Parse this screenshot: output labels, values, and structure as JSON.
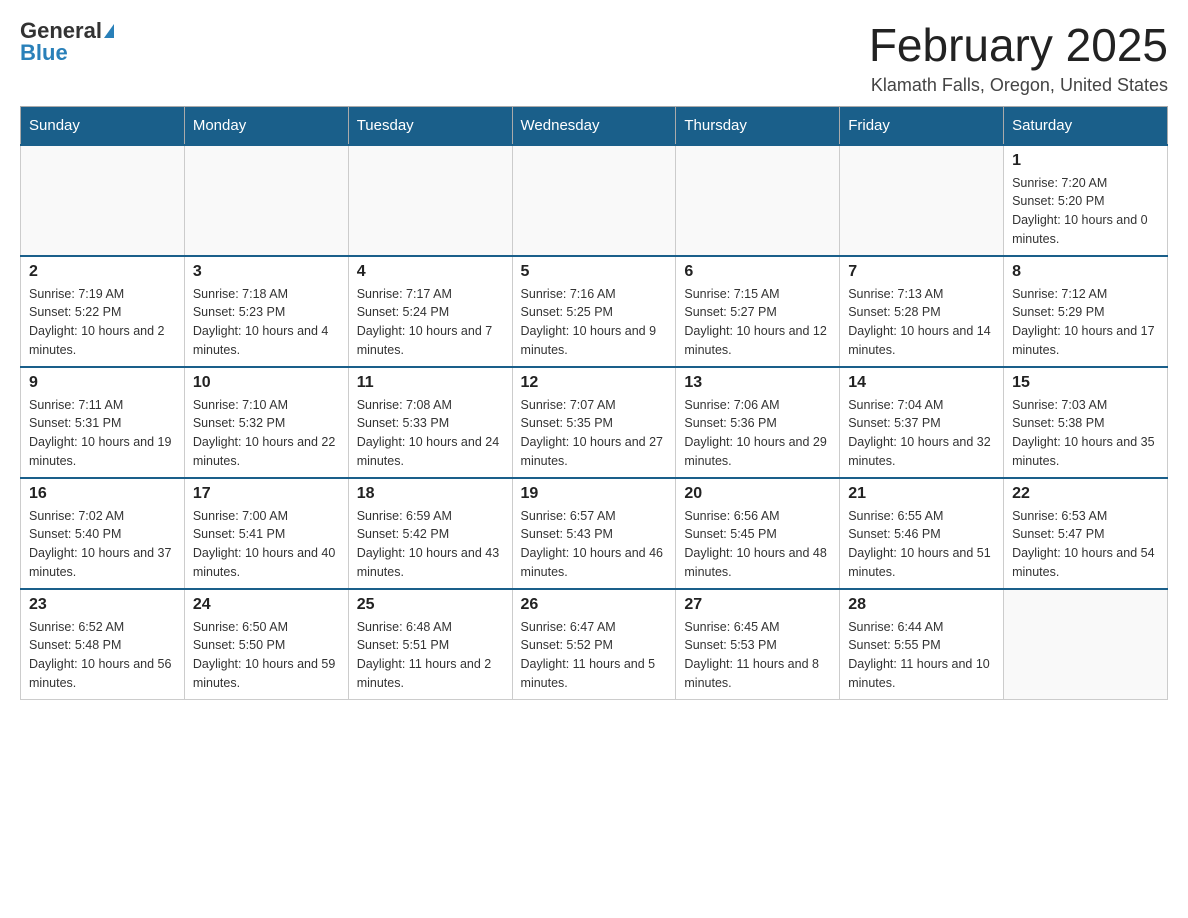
{
  "header": {
    "logo_general": "General",
    "logo_blue": "Blue",
    "title": "February 2025",
    "location": "Klamath Falls, Oregon, United States"
  },
  "days_of_week": [
    "Sunday",
    "Monday",
    "Tuesday",
    "Wednesday",
    "Thursday",
    "Friday",
    "Saturday"
  ],
  "weeks": [
    {
      "days": [
        {
          "date": "",
          "info": ""
        },
        {
          "date": "",
          "info": ""
        },
        {
          "date": "",
          "info": ""
        },
        {
          "date": "",
          "info": ""
        },
        {
          "date": "",
          "info": ""
        },
        {
          "date": "",
          "info": ""
        },
        {
          "date": "1",
          "info": "Sunrise: 7:20 AM\nSunset: 5:20 PM\nDaylight: 10 hours and 0 minutes."
        }
      ]
    },
    {
      "days": [
        {
          "date": "2",
          "info": "Sunrise: 7:19 AM\nSunset: 5:22 PM\nDaylight: 10 hours and 2 minutes."
        },
        {
          "date": "3",
          "info": "Sunrise: 7:18 AM\nSunset: 5:23 PM\nDaylight: 10 hours and 4 minutes."
        },
        {
          "date": "4",
          "info": "Sunrise: 7:17 AM\nSunset: 5:24 PM\nDaylight: 10 hours and 7 minutes."
        },
        {
          "date": "5",
          "info": "Sunrise: 7:16 AM\nSunset: 5:25 PM\nDaylight: 10 hours and 9 minutes."
        },
        {
          "date": "6",
          "info": "Sunrise: 7:15 AM\nSunset: 5:27 PM\nDaylight: 10 hours and 12 minutes."
        },
        {
          "date": "7",
          "info": "Sunrise: 7:13 AM\nSunset: 5:28 PM\nDaylight: 10 hours and 14 minutes."
        },
        {
          "date": "8",
          "info": "Sunrise: 7:12 AM\nSunset: 5:29 PM\nDaylight: 10 hours and 17 minutes."
        }
      ]
    },
    {
      "days": [
        {
          "date": "9",
          "info": "Sunrise: 7:11 AM\nSunset: 5:31 PM\nDaylight: 10 hours and 19 minutes."
        },
        {
          "date": "10",
          "info": "Sunrise: 7:10 AM\nSunset: 5:32 PM\nDaylight: 10 hours and 22 minutes."
        },
        {
          "date": "11",
          "info": "Sunrise: 7:08 AM\nSunset: 5:33 PM\nDaylight: 10 hours and 24 minutes."
        },
        {
          "date": "12",
          "info": "Sunrise: 7:07 AM\nSunset: 5:35 PM\nDaylight: 10 hours and 27 minutes."
        },
        {
          "date": "13",
          "info": "Sunrise: 7:06 AM\nSunset: 5:36 PM\nDaylight: 10 hours and 29 minutes."
        },
        {
          "date": "14",
          "info": "Sunrise: 7:04 AM\nSunset: 5:37 PM\nDaylight: 10 hours and 32 minutes."
        },
        {
          "date": "15",
          "info": "Sunrise: 7:03 AM\nSunset: 5:38 PM\nDaylight: 10 hours and 35 minutes."
        }
      ]
    },
    {
      "days": [
        {
          "date": "16",
          "info": "Sunrise: 7:02 AM\nSunset: 5:40 PM\nDaylight: 10 hours and 37 minutes."
        },
        {
          "date": "17",
          "info": "Sunrise: 7:00 AM\nSunset: 5:41 PM\nDaylight: 10 hours and 40 minutes."
        },
        {
          "date": "18",
          "info": "Sunrise: 6:59 AM\nSunset: 5:42 PM\nDaylight: 10 hours and 43 minutes."
        },
        {
          "date": "19",
          "info": "Sunrise: 6:57 AM\nSunset: 5:43 PM\nDaylight: 10 hours and 46 minutes."
        },
        {
          "date": "20",
          "info": "Sunrise: 6:56 AM\nSunset: 5:45 PM\nDaylight: 10 hours and 48 minutes."
        },
        {
          "date": "21",
          "info": "Sunrise: 6:55 AM\nSunset: 5:46 PM\nDaylight: 10 hours and 51 minutes."
        },
        {
          "date": "22",
          "info": "Sunrise: 6:53 AM\nSunset: 5:47 PM\nDaylight: 10 hours and 54 minutes."
        }
      ]
    },
    {
      "days": [
        {
          "date": "23",
          "info": "Sunrise: 6:52 AM\nSunset: 5:48 PM\nDaylight: 10 hours and 56 minutes."
        },
        {
          "date": "24",
          "info": "Sunrise: 6:50 AM\nSunset: 5:50 PM\nDaylight: 10 hours and 59 minutes."
        },
        {
          "date": "25",
          "info": "Sunrise: 6:48 AM\nSunset: 5:51 PM\nDaylight: 11 hours and 2 minutes."
        },
        {
          "date": "26",
          "info": "Sunrise: 6:47 AM\nSunset: 5:52 PM\nDaylight: 11 hours and 5 minutes."
        },
        {
          "date": "27",
          "info": "Sunrise: 6:45 AM\nSunset: 5:53 PM\nDaylight: 11 hours and 8 minutes."
        },
        {
          "date": "28",
          "info": "Sunrise: 6:44 AM\nSunset: 5:55 PM\nDaylight: 11 hours and 10 minutes."
        },
        {
          "date": "",
          "info": ""
        }
      ]
    }
  ]
}
